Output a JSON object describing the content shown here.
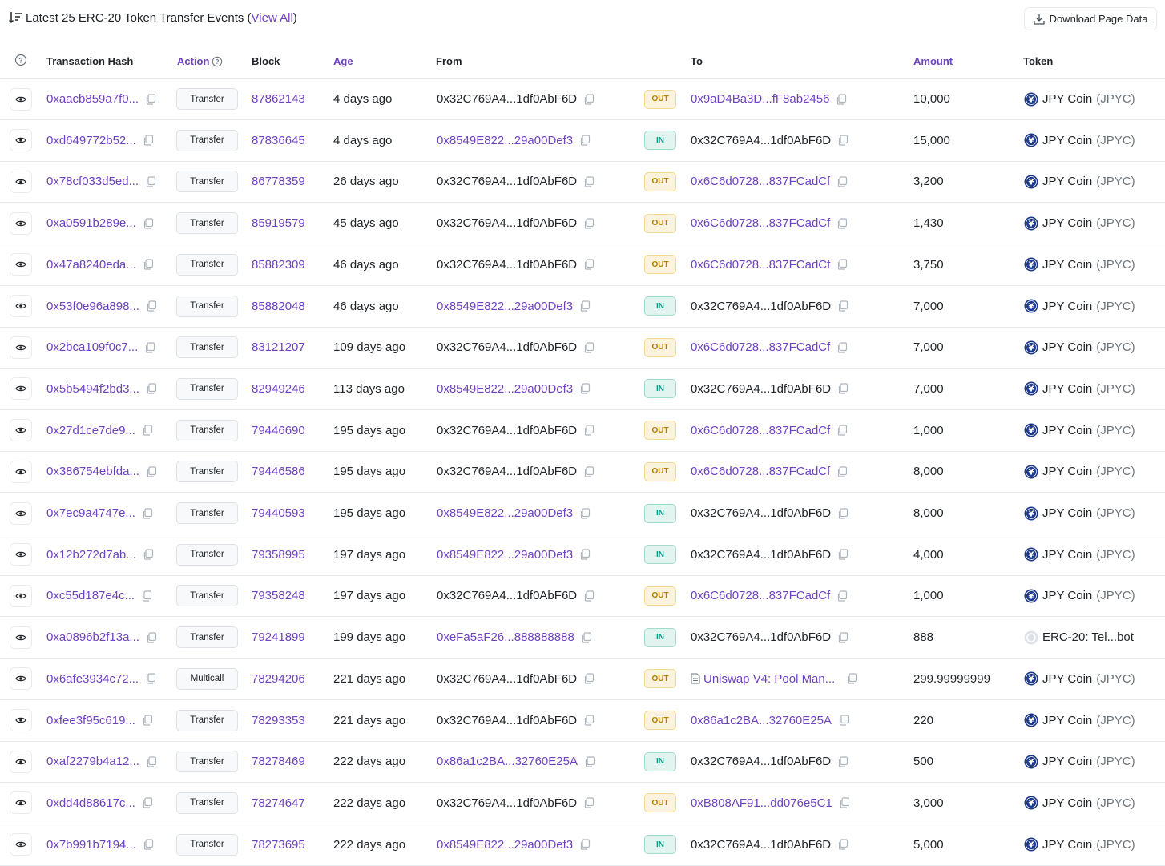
{
  "header": {
    "title": "Latest 25 ERC-20 Token Transfer Events (",
    "view_all": "View All",
    "title_end": ")",
    "download_label": "Download Page Data"
  },
  "columns": {
    "tx_hash": "Transaction Hash",
    "action": "Action",
    "block": "Block",
    "age": "Age",
    "from": "From",
    "to": "To",
    "amount": "Amount",
    "token": "Token"
  },
  "colors": {
    "accent": "#6f42c1",
    "out": "#b47d00",
    "in": "#00a186",
    "jpyc": "#1e3a8a"
  },
  "rows": [
    {
      "hash": "0xaacb859a7f0...",
      "action": "Transfer",
      "block": "87862143",
      "age": "4 days ago",
      "from": "0x32C769A4...1df0AbF6D",
      "from_link": false,
      "dir": "OUT",
      "to": "0x9aD4Ba3D...fF8ab2456",
      "to_link": true,
      "amount": "10,000",
      "token": "JPY Coin",
      "sym": "(JPYC)"
    },
    {
      "hash": "0xd649772b52...",
      "action": "Transfer",
      "block": "87836645",
      "age": "4 days ago",
      "from": "0x8549E822...29a00Def3",
      "from_link": true,
      "dir": "IN",
      "to": "0x32C769A4...1df0AbF6D",
      "to_link": false,
      "amount": "15,000",
      "token": "JPY Coin",
      "sym": "(JPYC)"
    },
    {
      "hash": "0x78cf033d5ed...",
      "action": "Transfer",
      "block": "86778359",
      "age": "26 days ago",
      "from": "0x32C769A4...1df0AbF6D",
      "from_link": false,
      "dir": "OUT",
      "to": "0x6C6d0728...837FCadCf",
      "to_link": true,
      "amount": "3,200",
      "token": "JPY Coin",
      "sym": "(JPYC)"
    },
    {
      "hash": "0xa0591b289e...",
      "action": "Transfer",
      "block": "85919579",
      "age": "45 days ago",
      "from": "0x32C769A4...1df0AbF6D",
      "from_link": false,
      "dir": "OUT",
      "to": "0x6C6d0728...837FCadCf",
      "to_link": true,
      "amount": "1,430",
      "token": "JPY Coin",
      "sym": "(JPYC)"
    },
    {
      "hash": "0x47a8240eda...",
      "action": "Transfer",
      "block": "85882309",
      "age": "46 days ago",
      "from": "0x32C769A4...1df0AbF6D",
      "from_link": false,
      "dir": "OUT",
      "to": "0x6C6d0728...837FCadCf",
      "to_link": true,
      "amount": "3,750",
      "token": "JPY Coin",
      "sym": "(JPYC)"
    },
    {
      "hash": "0x53f0e96a898...",
      "action": "Transfer",
      "block": "85882048",
      "age": "46 days ago",
      "from": "0x8549E822...29a00Def3",
      "from_link": true,
      "dir": "IN",
      "to": "0x32C769A4...1df0AbF6D",
      "to_link": false,
      "amount": "7,000",
      "token": "JPY Coin",
      "sym": "(JPYC)"
    },
    {
      "hash": "0x2bca109f0c7...",
      "action": "Transfer",
      "block": "83121207",
      "age": "109 days ago",
      "from": "0x32C769A4...1df0AbF6D",
      "from_link": false,
      "dir": "OUT",
      "to": "0x6C6d0728...837FCadCf",
      "to_link": true,
      "amount": "7,000",
      "token": "JPY Coin",
      "sym": "(JPYC)"
    },
    {
      "hash": "0x5b5494f2bd3...",
      "action": "Transfer",
      "block": "82949246",
      "age": "113 days ago",
      "from": "0x8549E822...29a00Def3",
      "from_link": true,
      "dir": "IN",
      "to": "0x32C769A4...1df0AbF6D",
      "to_link": false,
      "amount": "7,000",
      "token": "JPY Coin",
      "sym": "(JPYC)"
    },
    {
      "hash": "0x27d1ce7de9...",
      "action": "Transfer",
      "block": "79446690",
      "age": "195 days ago",
      "from": "0x32C769A4...1df0AbF6D",
      "from_link": false,
      "dir": "OUT",
      "to": "0x6C6d0728...837FCadCf",
      "to_link": true,
      "amount": "1,000",
      "token": "JPY Coin",
      "sym": "(JPYC)"
    },
    {
      "hash": "0x386754ebfda...",
      "action": "Transfer",
      "block": "79446586",
      "age": "195 days ago",
      "from": "0x32C769A4...1df0AbF6D",
      "from_link": false,
      "dir": "OUT",
      "to": "0x6C6d0728...837FCadCf",
      "to_link": true,
      "amount": "8,000",
      "token": "JPY Coin",
      "sym": "(JPYC)"
    },
    {
      "hash": "0x7ec9a4747e...",
      "action": "Transfer",
      "block": "79440593",
      "age": "195 days ago",
      "from": "0x8549E822...29a00Def3",
      "from_link": true,
      "dir": "IN",
      "to": "0x32C769A4...1df0AbF6D",
      "to_link": false,
      "amount": "8,000",
      "token": "JPY Coin",
      "sym": "(JPYC)"
    },
    {
      "hash": "0x12b272d7ab...",
      "action": "Transfer",
      "block": "79358995",
      "age": "197 days ago",
      "from": "0x8549E822...29a00Def3",
      "from_link": true,
      "dir": "IN",
      "to": "0x32C769A4...1df0AbF6D",
      "to_link": false,
      "amount": "4,000",
      "token": "JPY Coin",
      "sym": "(JPYC)"
    },
    {
      "hash": "0xc55d187e4c...",
      "action": "Transfer",
      "block": "79358248",
      "age": "197 days ago",
      "from": "0x32C769A4...1df0AbF6D",
      "from_link": false,
      "dir": "OUT",
      "to": "0x6C6d0728...837FCadCf",
      "to_link": true,
      "amount": "1,000",
      "token": "JPY Coin",
      "sym": "(JPYC)"
    },
    {
      "hash": "0xa0896b2f13a...",
      "action": "Transfer",
      "block": "79241899",
      "age": "199 days ago",
      "from": "0xeFa5aF26...888888888",
      "from_link": true,
      "dir": "IN",
      "to": "0x32C769A4...1df0AbF6D",
      "to_link": false,
      "amount": "888",
      "token": "ERC-20: Tel...bot",
      "sym": "",
      "token_icon": "generic"
    },
    {
      "hash": "0x6afe3934c72...",
      "action": "Multicall",
      "block": "78294206",
      "age": "221 days ago",
      "from": "0x32C769A4...1df0AbF6D",
      "from_link": false,
      "dir": "OUT",
      "to": "Uniswap V4: Pool Man...",
      "to_link": true,
      "to_contract": true,
      "amount": "299.99999999",
      "token": "JPY Coin",
      "sym": "(JPYC)"
    },
    {
      "hash": "0xfee3f95c619...",
      "action": "Transfer",
      "block": "78293353",
      "age": "221 days ago",
      "from": "0x32C769A4...1df0AbF6D",
      "from_link": false,
      "dir": "OUT",
      "to": "0x86a1c2BA...32760E25A",
      "to_link": true,
      "amount": "220",
      "token": "JPY Coin",
      "sym": "(JPYC)"
    },
    {
      "hash": "0xaf2279b4a12...",
      "action": "Transfer",
      "block": "78278469",
      "age": "222 days ago",
      "from": "0x86a1c2BA...32760E25A",
      "from_link": true,
      "dir": "IN",
      "to": "0x32C769A4...1df0AbF6D",
      "to_link": false,
      "amount": "500",
      "token": "JPY Coin",
      "sym": "(JPYC)"
    },
    {
      "hash": "0xdd4d88617c...",
      "action": "Transfer",
      "block": "78274647",
      "age": "222 days ago",
      "from": "0x32C769A4...1df0AbF6D",
      "from_link": false,
      "dir": "OUT",
      "to": "0xB808AF91...dd076e5C1",
      "to_link": true,
      "amount": "3,000",
      "token": "JPY Coin",
      "sym": "(JPYC)"
    },
    {
      "hash": "0x7b991b7194...",
      "action": "Transfer",
      "block": "78273695",
      "age": "222 days ago",
      "from": "0x8549E822...29a00Def3",
      "from_link": true,
      "dir": "IN",
      "to": "0x32C769A4...1df0AbF6D",
      "to_link": false,
      "amount": "5,000",
      "token": "JPY Coin",
      "sym": "(JPYC)"
    }
  ]
}
